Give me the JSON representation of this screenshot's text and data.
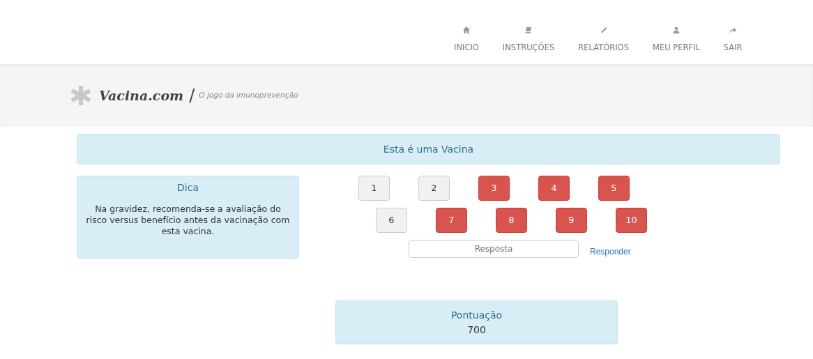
{
  "nav": [
    {
      "label": "INICIO"
    },
    {
      "label": "INSTRUÇÕES"
    },
    {
      "label": "RELATÓRIOS"
    },
    {
      "label": "MEU PERFIL"
    },
    {
      "label": "SAIR"
    }
  ],
  "brand": {
    "name": "Vacina.com",
    "separator": "/",
    "tagline": "O jogo da imunoprevenção"
  },
  "title": "Esta é uma Vacina",
  "hint": {
    "heading": "Dica",
    "text": "Na gravidez, recomenda-se a avaliação do risco versus benefício antes da vacinação com esta vacina."
  },
  "tiles": [
    [
      {
        "label": "1",
        "opened": false
      },
      {
        "label": "2",
        "opened": false
      },
      {
        "label": "3",
        "opened": true
      },
      {
        "label": "4",
        "opened": true
      },
      {
        "label": "5",
        "opened": true
      }
    ],
    [
      {
        "label": "6",
        "opened": false
      },
      {
        "label": "7",
        "opened": true
      },
      {
        "label": "8",
        "opened": true
      },
      {
        "label": "9",
        "opened": true
      },
      {
        "label": "10",
        "opened": true
      }
    ]
  ],
  "answer": {
    "placeholder": "Resposta",
    "button": "Responder"
  },
  "score": {
    "label": "Pontuação",
    "value": "700"
  }
}
